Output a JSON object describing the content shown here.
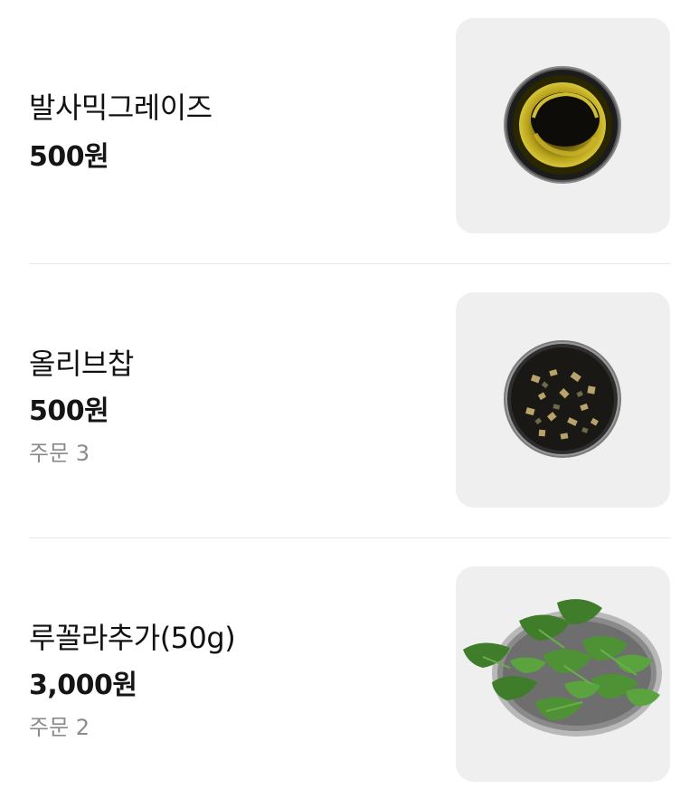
{
  "menu_items": [
    {
      "name": "발사믹그레이즈",
      "price": "500원",
      "orders": "",
      "image": "balsamic-glaze-bowl-image"
    },
    {
      "name": "올리브찹",
      "price": "500원",
      "orders": "주문 3",
      "image": "chopped-olive-bowl-image"
    },
    {
      "name": "루꼴라추가(50g)",
      "price": "3,000원",
      "orders": "주문 2",
      "image": "arugula-bowl-image"
    }
  ]
}
